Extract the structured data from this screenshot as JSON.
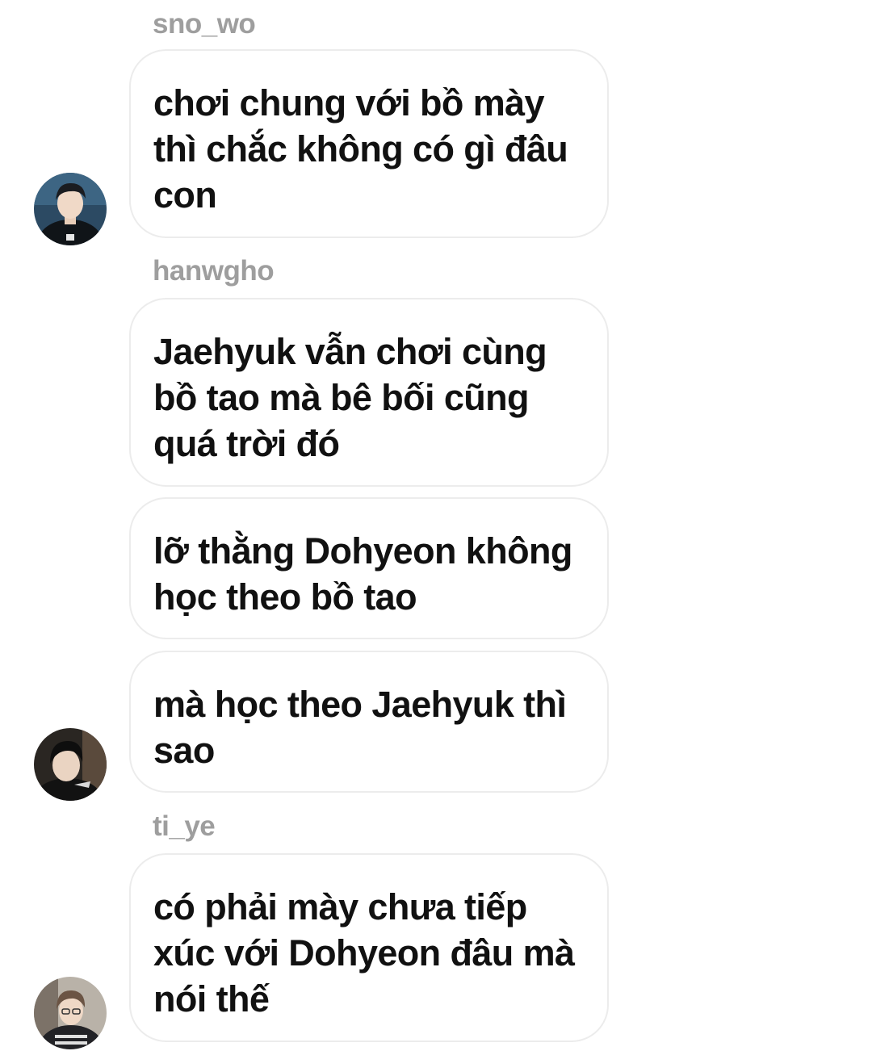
{
  "chat": {
    "groups": [
      {
        "username": "sno_wo",
        "avatar_icon": "user-avatar-photo",
        "messages": [
          "chơi chung với bồ mày thì chắc không có gì đâu con"
        ]
      },
      {
        "username": "hanwgho",
        "avatar_icon": "user-avatar-photo",
        "messages": [
          "Jaehyuk vẫn chơi cùng bồ tao mà bê bối cũng quá trời đó",
          "lỡ thằng Dohyeon không học theo bồ tao",
          "mà học theo Jaehyuk thì sao"
        ]
      },
      {
        "username": "ti_ye",
        "avatar_icon": "user-avatar-photo",
        "messages": [
          "có phải mày chưa tiếp xúc với Dohyeon đâu mà nói thế"
        ]
      }
    ]
  },
  "colors": {
    "background": "#ffffff",
    "bubble_border": "#ececec",
    "username": "#9e9e9e",
    "message_text": "#111111"
  }
}
